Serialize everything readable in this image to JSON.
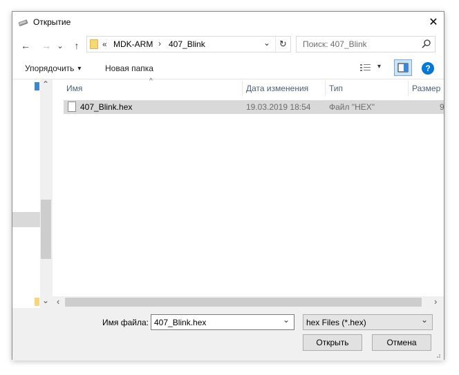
{
  "window": {
    "title": "Открытие",
    "close_glyph": "✕"
  },
  "nav": {
    "back": "←",
    "forward": "→",
    "recent": "⌄",
    "up": "↑",
    "breadcrumb_prefix": "«",
    "breadcrumb": [
      "MDK-ARM",
      "407_Blink"
    ],
    "breadcrumb_sep": "›",
    "dropdown": "⌄",
    "refresh": "↻",
    "search_placeholder": "Поиск: 407_Blink"
  },
  "toolbar": {
    "organize": "Упорядочить",
    "organize_arrow": "▾",
    "new_folder": "Новая папка",
    "view_arrow": "▾",
    "help": "?"
  },
  "columns": {
    "name": "Имя",
    "date": "Дата изменения",
    "type": "Тип",
    "size": "Размер",
    "sort_glyph": "^"
  },
  "files": [
    {
      "name": "407_Blink.hex",
      "date": "19.03.2019 18:54",
      "type": "Файл \"HEX\"",
      "size": "9"
    }
  ],
  "scroll": {
    "up": "⌃",
    "down": "⌄",
    "left": "‹",
    "right": "›"
  },
  "bottom": {
    "filename_label": "Имя файла:",
    "filename_value": "407_Blink.hex",
    "filter_value": "hex Files (*.hex)",
    "open_label": "Открыть",
    "cancel_label": "Отмена"
  },
  "colors": {
    "accent": "#0078d7",
    "folder": "#f8d775",
    "selection": "#d9d9d9"
  }
}
